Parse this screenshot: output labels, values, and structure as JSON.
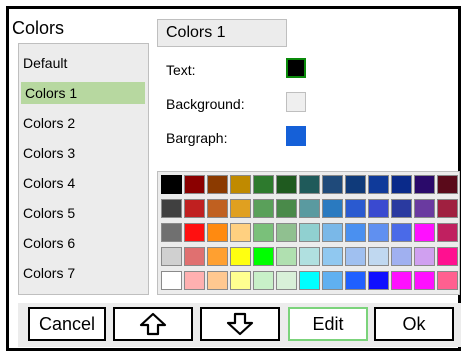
{
  "dialog": {
    "title": "Colors"
  },
  "scheme_list": {
    "items": [
      "Default",
      "Colors 1",
      "Colors 2",
      "Colors 3",
      "Colors 4",
      "Colors 5",
      "Colors 6",
      "Colors 7"
    ],
    "selected_index": 1,
    "selected_color": "#b7d8a0"
  },
  "scheme_name": "Colors 1",
  "properties": {
    "text": {
      "label": "Text:",
      "color": "#000000"
    },
    "background": {
      "label": "Background:",
      "color": "#efefef"
    },
    "bargraph": {
      "label": "Bargraph:",
      "color": "#1560d8"
    }
  },
  "palette": {
    "selected": [
      0,
      0
    ],
    "rows": [
      [
        "#000000",
        "#8b0000",
        "#8b3a00",
        "#c08a00",
        "#2d7a2d",
        "#1f5a1f",
        "#1f5a5a",
        "#1f4a7a",
        "#0f3a7a",
        "#0f3a9a",
        "#0a2a8a",
        "#2a0a6a",
        "#5a0a1a"
      ],
      [
        "#404040",
        "#c02020",
        "#c06020",
        "#e0a020",
        "#5aa05a",
        "#4a8a4a",
        "#5a9aa0",
        "#2a7ac0",
        "#2a5ad0",
        "#3a4ad0",
        "#2a3aa0",
        "#6a3aa0",
        "#a02040"
      ],
      [
        "#707070",
        "#ff1010",
        "#ff8a10",
        "#ffd080",
        "#7ac07a",
        "#90c090",
        "#90d0d0",
        "#7ab8e8",
        "#4a90f0",
        "#6090f0",
        "#4a6ae8",
        "#ff10ff",
        "#c02060"
      ],
      [
        "#d0d0d0",
        "#e07070",
        "#ffa030",
        "#ffff10",
        "#00ff00",
        "#b0e0b0",
        "#b0e0e0",
        "#90c8f0",
        "#a0c0f0",
        "#c0d8f0",
        "#a0b0f0",
        "#d0a0f0",
        "#ff1090"
      ],
      [
        "#ffffff",
        "#ffb0b0",
        "#ffc890",
        "#ffff90",
        "#c8f0c8",
        "#d8f0d8",
        "#00ffff",
        "#60b0f0",
        "#2060ff",
        "#1010ff",
        "#ff10ff",
        "#ff10ff",
        "#ff6090"
      ]
    ]
  },
  "buttons": {
    "cancel": "Cancel",
    "up_icon": "arrow-up-icon",
    "down_icon": "arrow-down-icon",
    "edit": "Edit",
    "ok": "Ok"
  }
}
